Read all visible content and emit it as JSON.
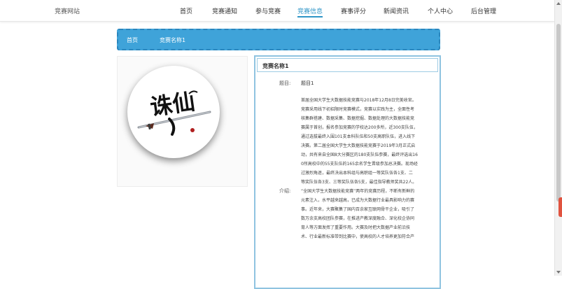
{
  "header": {
    "site_name": "竞赛网站",
    "nav": [
      {
        "label": "首页"
      },
      {
        "label": "竞赛通知"
      },
      {
        "label": "参与竞赛"
      },
      {
        "label": "竞赛信息",
        "active": true
      },
      {
        "label": "赛事评分"
      },
      {
        "label": "新闻资讯"
      },
      {
        "label": "个人中心"
      },
      {
        "label": "后台管理"
      }
    ]
  },
  "breadcrumb": {
    "home": "首页",
    "current": "竞赛名称1"
  },
  "image": {
    "alt": "竞赛图片",
    "icon": "calligraphy-sword-image"
  },
  "detail": {
    "title": "竞赛名称1",
    "topic_label": "题目:",
    "topic_value": "题目1",
    "intro_label": "介绍:",
    "intro_lines": [
      "首届全国大学生大数据技能竞赛与2018年12月8日完美收官。",
      "竞赛采用线下初招限时竞赛模式，竞赛以实践为主，全面性考",
      "核集群搭建、数据采集、数据挖掘、数据处理的大数据技能竞",
      "赛属于首创，报名参加竞赛的学校达200多所，近300支队伍，",
      "通过选拔最终入围101支本科队伍和50支高职队伍，进入线下",
      "决赛。第二届全国大学生大数据技能竞赛于2019年3月正式启",
      "动，共有来自全国8大分赛区的180支队伍参赛，最终评选出16",
      "0所高校中的55支队伍的165余名学生晋级参加总决赛。现场经",
      "过激烈角逐，最终决出本科组与高职组一等奖队伍各1支、二",
      "等奖队伍各3支、三等奖队伍各5支，最佳指导教师奖共22人。",
      "“全国大学生大数据技能竞赛”两年的竞赛历程，不断有新鲜的",
      "元素注入，水平越来越高，已成为大数据行业最具影响力的赛",
      "事。近年来，大赛聚集了国内百余家互联网骨干企业，吸引了",
      "数万余支高校团队参赛，在推进产教深度融合、深化校企协同",
      "育人等方面发挥了重要作用。大赛及时把大数据产业前沿技",
      "术、行业最新标准带到比赛中，使高校的人才培养更加符合产"
    ]
  },
  "colors": {
    "accent": "#2f95c7",
    "breadcrumb_bg": "#3fa3d9",
    "panel_border": "#8fc3e0"
  }
}
